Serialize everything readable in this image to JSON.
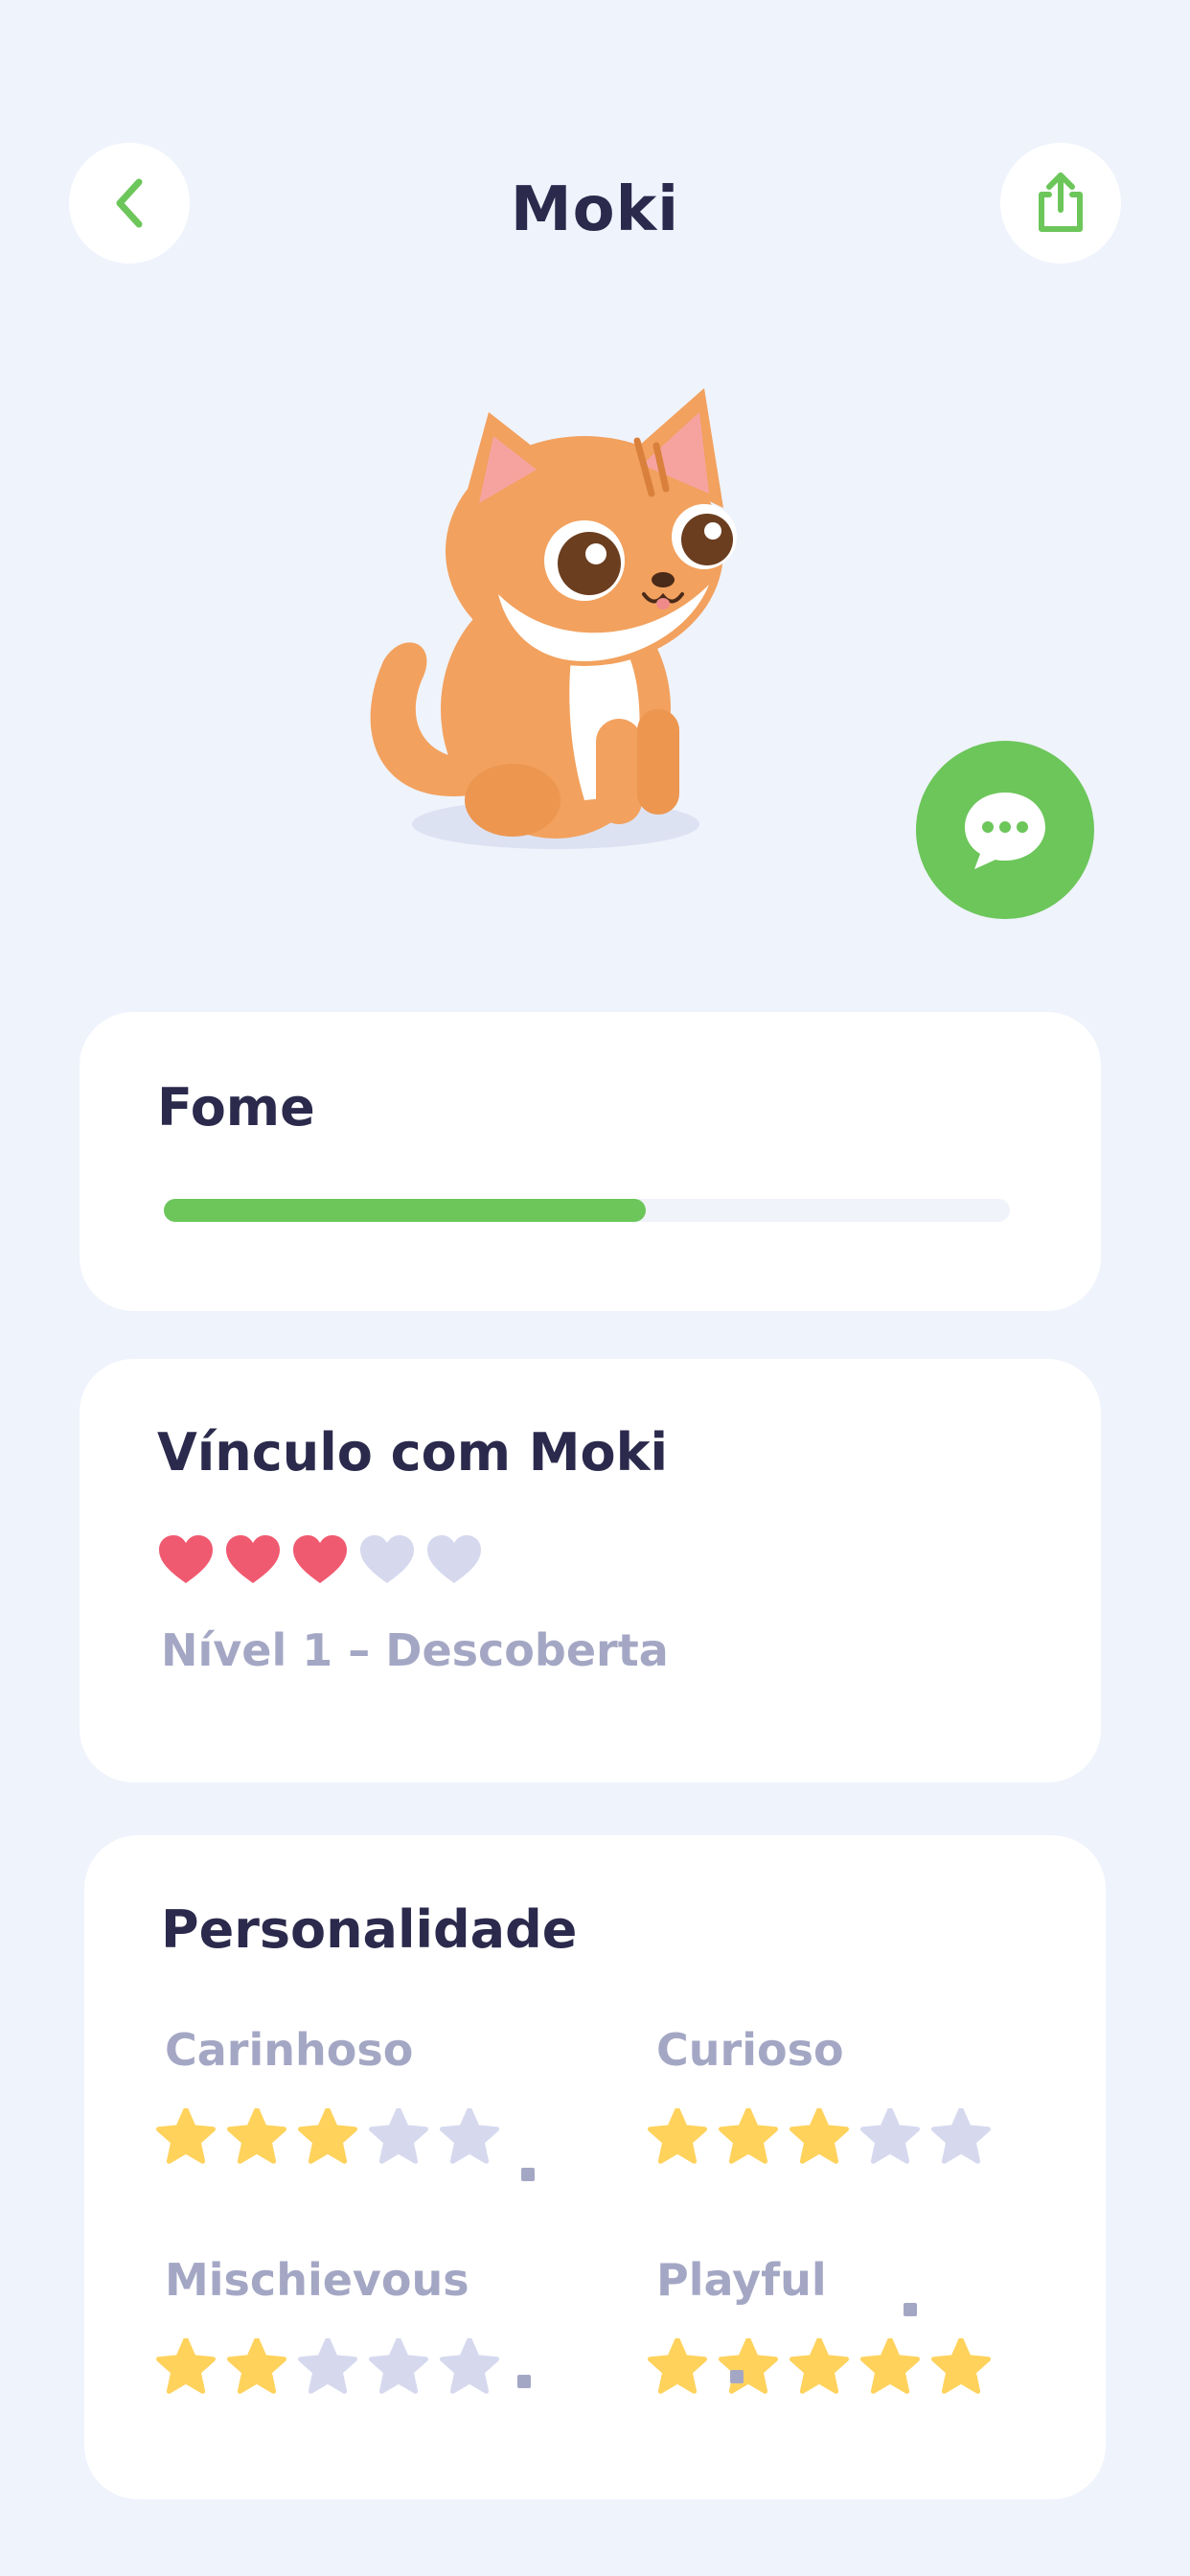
{
  "header": {
    "title": "Moki",
    "back_icon": "chevron-left-icon",
    "share_icon": "share-icon"
  },
  "pet": {
    "illustration": "orange-cat-illustration"
  },
  "chat_button": {
    "icon": "chat-bubble-icon"
  },
  "hunger": {
    "title": "Fome",
    "level_fraction": 0.57
  },
  "bond": {
    "title": "Vínculo com Moki",
    "hearts_filled": 3,
    "hearts_total": 5,
    "level_text": "Nível 1 – Descoberta"
  },
  "personality": {
    "title": "Personalidade",
    "traits": [
      {
        "label": "Carinhoso",
        "stars": 3,
        "max": 5
      },
      {
        "label": "Curioso",
        "stars": 3,
        "max": 5
      },
      {
        "label": "Mischievous",
        "stars": 2,
        "max": 5
      },
      {
        "label": "Playful",
        "stars": 5,
        "max": 5
      }
    ]
  },
  "colors": {
    "background": "#eff3fc",
    "accent_green": "#6cc65a",
    "heart_filled": "#f05a70",
    "heart_empty": "#d6d9ee",
    "star_filled": "#ffd25c",
    "star_empty": "#d6d9ee",
    "muted_text": "#a4a7c4",
    "dark_text": "#2b2a4c"
  }
}
